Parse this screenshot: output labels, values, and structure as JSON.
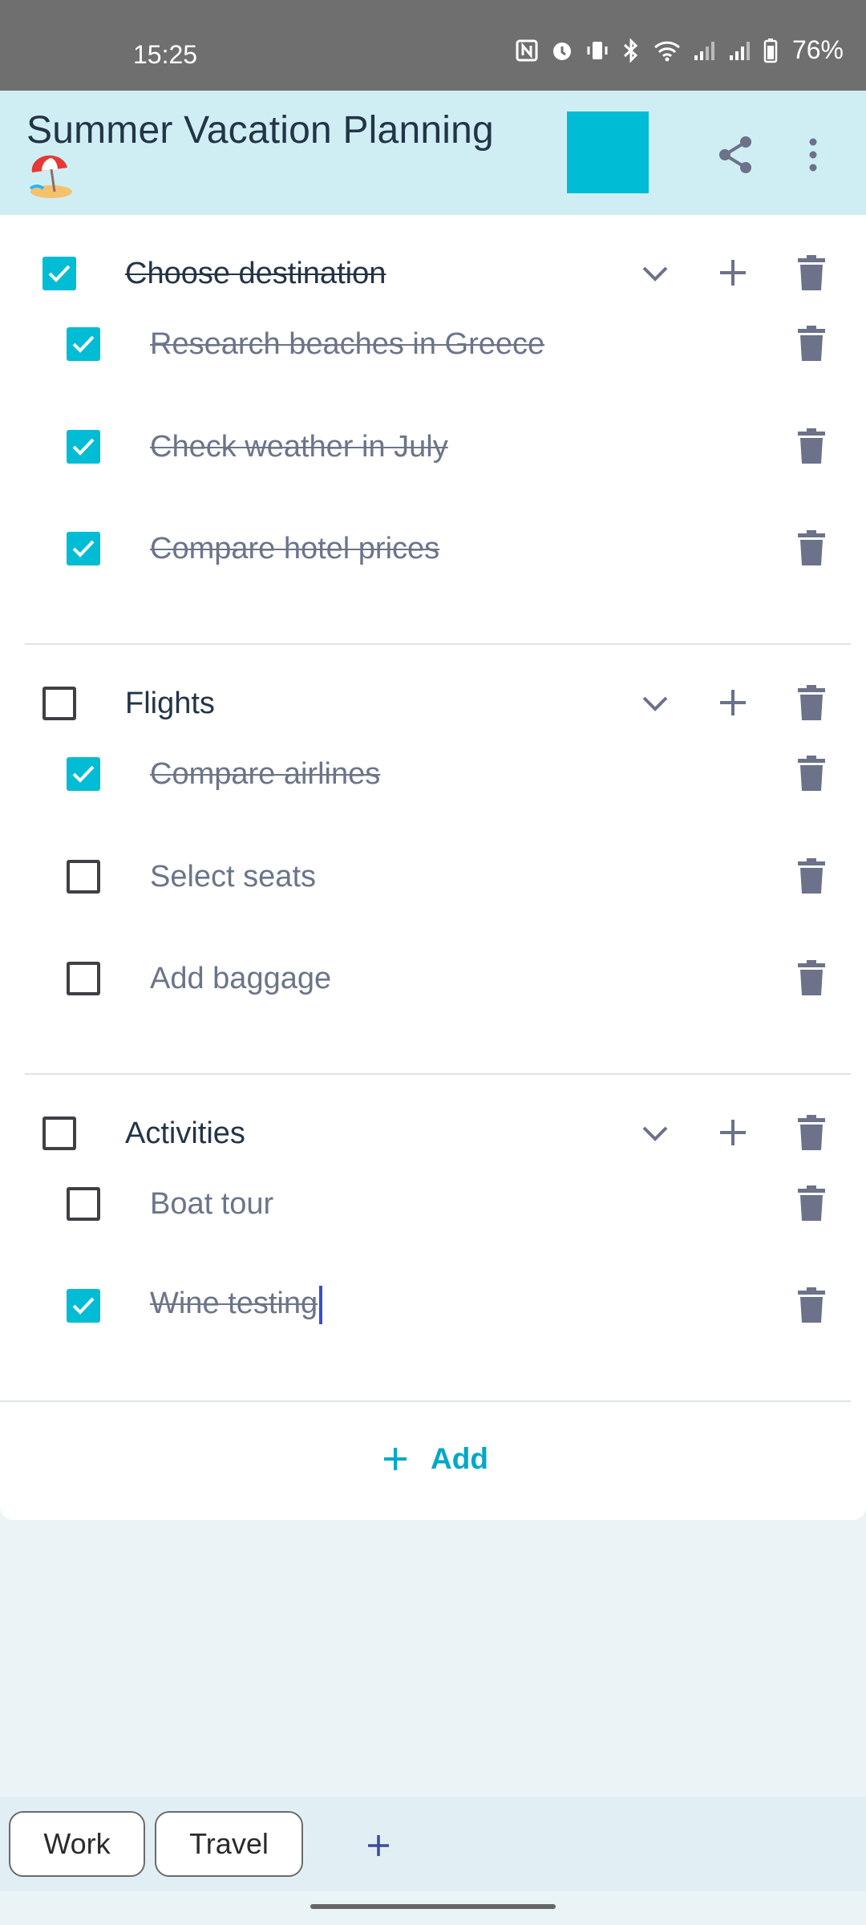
{
  "status_bar": {
    "time": "15:25",
    "battery": "76%",
    "icons": [
      "nfc-icon",
      "alarm-icon",
      "vibrate-icon",
      "bluetooth-icon",
      "wifi-icon",
      "signal-icon",
      "signal-icon",
      "battery-icon"
    ]
  },
  "app_bar": {
    "title": "Summer Vacation Planning",
    "emoji_icon": "beach-umbrella-icon",
    "swatch_color": "#00bcd4",
    "share_icon": "share-icon",
    "more_icon": "more-vert-icon"
  },
  "groups": [
    {
      "label": "Choose destination",
      "checked": true,
      "items": [
        {
          "label": "Research beaches in Greece",
          "checked": true
        },
        {
          "label": "Check weather in July",
          "checked": true
        },
        {
          "label": "Compare hotel prices",
          "checked": true
        }
      ]
    },
    {
      "label": "Flights",
      "checked": false,
      "items": [
        {
          "label": "Compare airlines",
          "checked": true
        },
        {
          "label": "Select seats",
          "checked": false
        },
        {
          "label": "Add baggage",
          "checked": false
        }
      ]
    },
    {
      "label": "Activities",
      "checked": false,
      "items": [
        {
          "label": "Boat tour",
          "checked": false
        },
        {
          "label": "Wine testing",
          "checked": true
        }
      ]
    }
  ],
  "add_button": {
    "label": "Add"
  },
  "tabs": [
    {
      "label": "Work"
    },
    {
      "label": "Travel"
    }
  ],
  "colors": {
    "accent": "#00bcd4",
    "appbar": "#cfeef4",
    "icon": "#6b7289"
  }
}
